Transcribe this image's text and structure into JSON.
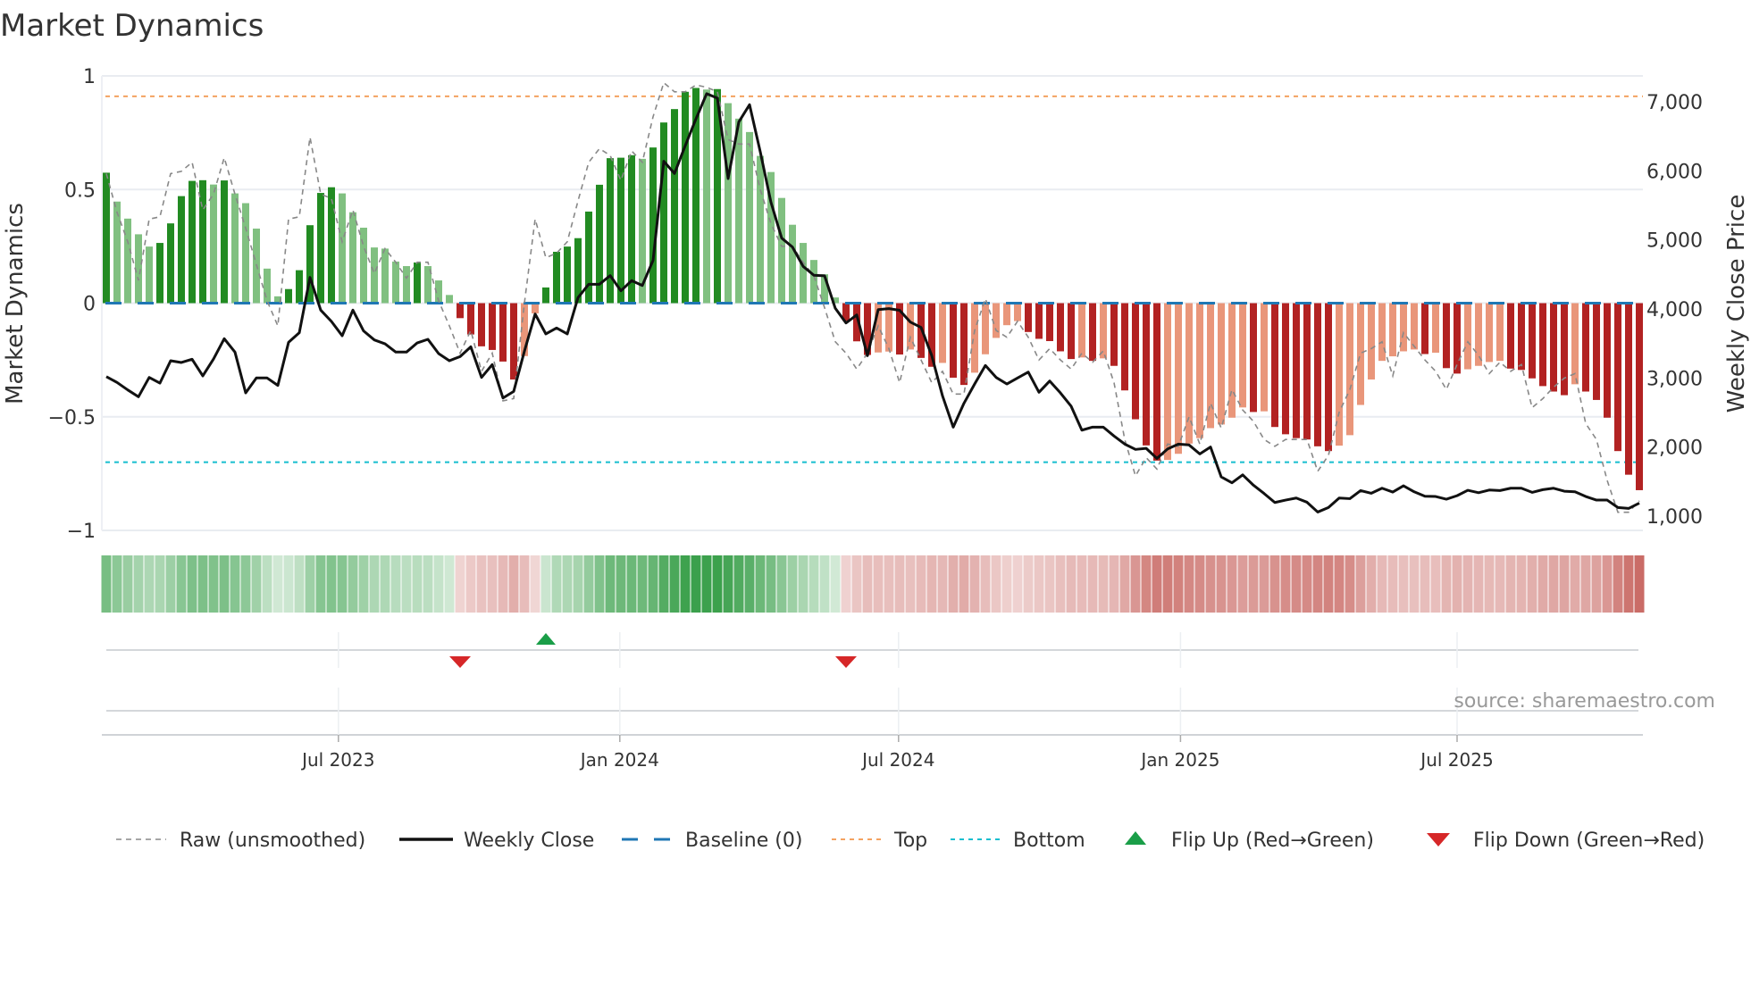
{
  "chart_data": {
    "type": "bar",
    "title": "Market Dynamics",
    "ylabel": "Market Dynamics",
    "ylabel_right": "Weekly Close Price",
    "ylim": [
      -1,
      1
    ],
    "ylim_right": [
      792,
      7376
    ],
    "y_ticks": [
      {
        "v": 1,
        "label": "1"
      },
      {
        "v": 0.5,
        "label": "0.5"
      },
      {
        "v": 0,
        "label": "0"
      },
      {
        "v": -0.5,
        "label": "−0.5"
      },
      {
        "v": -1,
        "label": "−1"
      }
    ],
    "y_ticks_right": [
      {
        "v": 7000,
        "label": "7,000"
      },
      {
        "v": 6000,
        "label": "6,000"
      },
      {
        "v": 5000,
        "label": "5,000"
      },
      {
        "v": 4000,
        "label": "4,000"
      },
      {
        "v": 3000,
        "label": "3,000"
      },
      {
        "v": 2000,
        "label": "2,000"
      },
      {
        "v": 1000,
        "label": "1,000"
      }
    ],
    "x_unit": "week index",
    "x_ticks": [
      {
        "week": 21.65,
        "label": "Jul 2023"
      },
      {
        "week": 47.9,
        "label": "Jan 2024"
      },
      {
        "week": 73.9,
        "label": "Jul 2024"
      },
      {
        "week": 100.2,
        "label": "Jan 2025"
      },
      {
        "week": 126.0,
        "label": "Jul 2025"
      }
    ],
    "top_level": 0.91,
    "bottom_level": -0.7,
    "baseline": 0,
    "grid": true,
    "legend_position": "bottom",
    "values": [
      0.574,
      0.447,
      0.372,
      0.303,
      0.249,
      0.265,
      0.351,
      0.471,
      0.538,
      0.541,
      0.522,
      0.54,
      0.483,
      0.44,
      0.328,
      0.152,
      0.03,
      0.062,
      0.145,
      0.343,
      0.485,
      0.51,
      0.483,
      0.4,
      0.332,
      0.245,
      0.24,
      0.183,
      0.163,
      0.179,
      0.163,
      0.1,
      0.036,
      -0.066,
      -0.138,
      -0.19,
      -0.206,
      -0.257,
      -0.336,
      -0.233,
      -0.045,
      0.069,
      0.226,
      0.249,
      0.286,
      0.403,
      0.521,
      0.638,
      0.64,
      0.651,
      0.635,
      0.685,
      0.795,
      0.854,
      0.93,
      0.947,
      0.94,
      0.942,
      0.88,
      0.812,
      0.753,
      0.648,
      0.577,
      0.463,
      0.345,
      0.265,
      0.19,
      0.127,
      0.025,
      -0.078,
      -0.168,
      -0.228,
      -0.217,
      -0.213,
      -0.226,
      -0.204,
      -0.241,
      -0.28,
      -0.263,
      -0.328,
      -0.36,
      -0.306,
      -0.225,
      -0.153,
      -0.097,
      -0.079,
      -0.127,
      -0.157,
      -0.167,
      -0.212,
      -0.246,
      -0.239,
      -0.254,
      -0.243,
      -0.276,
      -0.384,
      -0.511,
      -0.626,
      -0.693,
      -0.69,
      -0.663,
      -0.618,
      -0.594,
      -0.55,
      -0.534,
      -0.504,
      -0.459,
      -0.479,
      -0.476,
      -0.545,
      -0.577,
      -0.594,
      -0.6,
      -0.63,
      -0.651,
      -0.627,
      -0.581,
      -0.448,
      -0.336,
      -0.254,
      -0.234,
      -0.212,
      -0.204,
      -0.224,
      -0.218,
      -0.286,
      -0.31,
      -0.291,
      -0.276,
      -0.259,
      -0.254,
      -0.288,
      -0.294,
      -0.331,
      -0.365,
      -0.389,
      -0.405,
      -0.357,
      -0.389,
      -0.426,
      -0.504,
      -0.651,
      -0.755,
      -0.823
    ],
    "raw": [
      0.57,
      0.4,
      0.27,
      0.1,
      0.37,
      0.38,
      0.57,
      0.58,
      0.62,
      0.41,
      0.48,
      0.64,
      0.48,
      0.33,
      0.17,
      0.01,
      -0.1,
      0.37,
      0.38,
      0.73,
      0.48,
      0.46,
      0.27,
      0.41,
      0.25,
      0.13,
      0.24,
      0.18,
      0.11,
      0.18,
      0.18,
      0.01,
      -0.1,
      -0.22,
      -0.12,
      -0.3,
      -0.22,
      -0.43,
      -0.42,
      0.0,
      0.37,
      0.2,
      0.22,
      0.27,
      0.45,
      0.62,
      0.68,
      0.65,
      0.54,
      0.67,
      0.62,
      0.82,
      0.97,
      0.93,
      0.93,
      0.96,
      0.95,
      0.93,
      0.72,
      0.7,
      0.7,
      0.5,
      0.35,
      0.25,
      0.25,
      0.18,
      0.12,
      -0.02,
      -0.17,
      -0.22,
      -0.29,
      -0.22,
      -0.1,
      -0.2,
      -0.35,
      -0.15,
      -0.25,
      -0.35,
      -0.3,
      -0.4,
      -0.4,
      -0.12,
      0.02,
      -0.12,
      -0.15,
      -0.08,
      -0.15,
      -0.25,
      -0.2,
      -0.25,
      -0.29,
      -0.22,
      -0.26,
      -0.21,
      -0.35,
      -0.6,
      -0.76,
      -0.68,
      -0.73,
      -0.62,
      -0.63,
      -0.5,
      -0.62,
      -0.44,
      -0.55,
      -0.38,
      -0.47,
      -0.52,
      -0.6,
      -0.63,
      -0.6,
      -0.6,
      -0.6,
      -0.74,
      -0.67,
      -0.48,
      -0.38,
      -0.22,
      -0.2,
      -0.17,
      -0.32,
      -0.13,
      -0.19,
      -0.25,
      -0.3,
      -0.38,
      -0.27,
      -0.17,
      -0.23,
      -0.31,
      -0.26,
      -0.3,
      -0.27,
      -0.46,
      -0.42,
      -0.37,
      -0.33,
      -0.31,
      -0.53,
      -0.6,
      -0.78,
      -0.92,
      -0.92,
      -0.87
    ],
    "close": [
      3020,
      2935,
      2827,
      2728,
      3008,
      2926,
      3250,
      3224,
      3271,
      3030,
      3275,
      3569,
      3375,
      2784,
      3000,
      3000,
      2892,
      3517,
      3655,
      4457,
      3983,
      3819,
      3612,
      3983,
      3681,
      3551,
      3495,
      3375,
      3375,
      3508,
      3560,
      3353,
      3250,
      3310,
      3452,
      3008,
      3194,
      2710,
      2805,
      3388,
      3927,
      3638,
      3724,
      3638,
      4164,
      4358,
      4358,
      4483,
      4263,
      4410,
      4340,
      4703,
      6139,
      5963,
      6364,
      6752,
      7118,
      7054,
      5889,
      6709,
      6959,
      6277,
      5544,
      5026,
      4897,
      4617,
      4488,
      4480,
      4009,
      3797,
      3913,
      3323,
      3990,
      4005,
      3980,
      3810,
      3732,
      3323,
      2741,
      2288,
      2633,
      2913,
      3181,
      3008,
      2913,
      3000,
      3086,
      2793,
      2956,
      2784,
      2590,
      2244,
      2288,
      2288,
      2159,
      2042,
      1965,
      1980,
      1835,
      1973,
      2042,
      2030,
      1900,
      2000,
      1567,
      1481,
      1597,
      1447,
      1326,
      1196,
      1231,
      1261,
      1200,
      1058,
      1123,
      1261,
      1252,
      1369,
      1330,
      1403,
      1347,
      1438,
      1351,
      1287,
      1283,
      1244,
      1295,
      1373,
      1338,
      1377,
      1369,
      1403,
      1403,
      1343,
      1382,
      1403,
      1360,
      1351,
      1283,
      1231,
      1231,
      1123,
      1110,
      1187
    ],
    "flips": [
      {
        "week": 33,
        "dir": "down"
      },
      {
        "week": 41,
        "dir": "up"
      },
      {
        "week": 69,
        "dir": "down"
      }
    ],
    "legend": [
      {
        "key": "raw",
        "label": "Raw (unsmoothed)"
      },
      {
        "key": "close",
        "label": "Weekly Close"
      },
      {
        "key": "baseline",
        "label": "Baseline (0)"
      },
      {
        "key": "top",
        "label": "Top"
      },
      {
        "key": "bottom",
        "label": "Bottom"
      },
      {
        "key": "flip_up",
        "label": "Flip Up (Red→Green)"
      },
      {
        "key": "flip_down",
        "label": "Flip Down (Green→Red)"
      }
    ],
    "source": "source: sharemaestro.com"
  },
  "colors": {
    "pos_strong": "#228b22",
    "pos_weak": "#80c080",
    "neg_strong": "#b22222",
    "neg_weak": "#e9967a",
    "raw": "#888888",
    "close": "#111111",
    "baseline": "#1f77b4",
    "top": "#f4a261",
    "bottom": "#17becf",
    "flip_up": "#1a9e48",
    "flip_down": "#d62728",
    "heat_pos": "#2e9a40",
    "heat_neg": "#c0504a"
  }
}
